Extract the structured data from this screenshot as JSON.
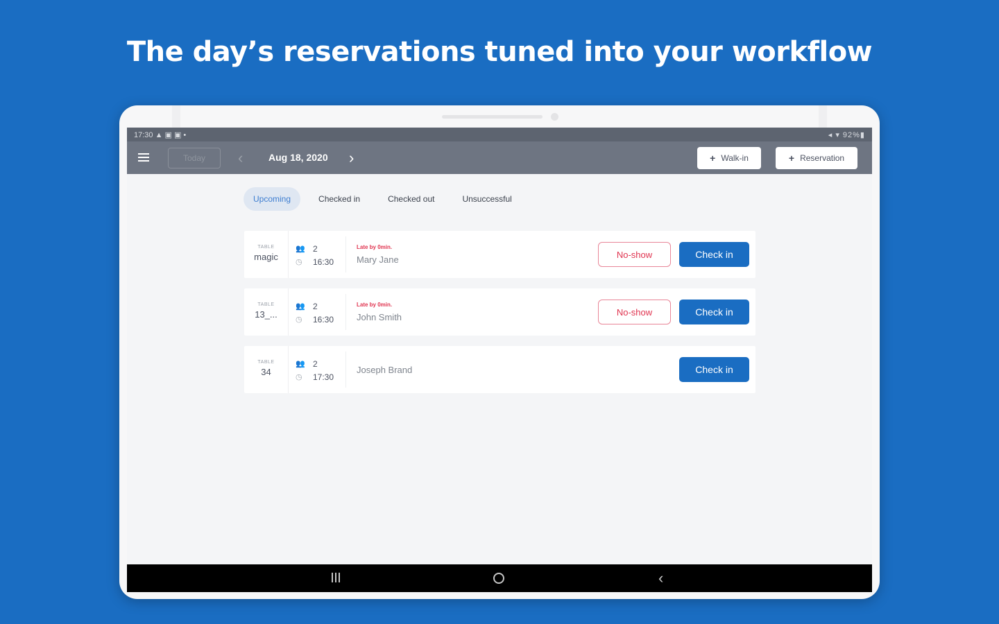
{
  "headline": "The day’s reservations tuned into your workflow",
  "statusbar": {
    "left": "17:30 ▲ ▣ ▣ •",
    "right": "◂ ▾ 92%▮"
  },
  "appbar": {
    "today_label": "Today",
    "date": "Aug 18, 2020",
    "walkin_label": "Walk-in",
    "reservation_label": "Reservation"
  },
  "tabs": [
    {
      "label": "Upcoming",
      "active": true
    },
    {
      "label": "Checked in"
    },
    {
      "label": "Checked out"
    },
    {
      "label": "Unsuccessful"
    }
  ],
  "reservations": [
    {
      "table_label": "TABLE",
      "table": "magic",
      "guests": "2",
      "time": "16:30",
      "status": "Late by 0min.",
      "name": "Mary Jane",
      "noshow_label": "No-show",
      "checkin_label": "Check in"
    },
    {
      "table_label": "TABLE",
      "table": "13_...",
      "guests": "2",
      "time": "16:30",
      "status": "Late by 0min.",
      "name": "John Smith",
      "noshow_label": "No-show",
      "checkin_label": "Check in"
    },
    {
      "table_label": "TABLE",
      "table": "34",
      "guests": "2",
      "time": "17:30",
      "status": "",
      "name": "Joseph Brand",
      "noshow_label": "",
      "checkin_label": "Check in"
    }
  ],
  "colors": {
    "brand": "#1a6dc2",
    "late": "#e0334f",
    "appbar": "#6e7582"
  }
}
